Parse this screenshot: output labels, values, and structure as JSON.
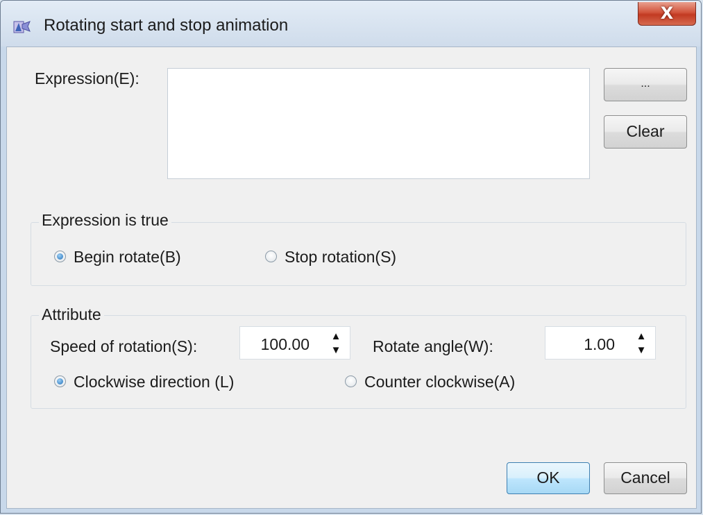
{
  "window": {
    "title": "Rotating start and stop animation",
    "close_label": "X"
  },
  "expression": {
    "label": "Expression(E):",
    "value": "",
    "browse_label": "...",
    "clear_label": "Clear"
  },
  "expression_true_group": {
    "title": "Expression is true",
    "options": [
      {
        "label": "Begin rotate(B)",
        "checked": true
      },
      {
        "label": "Stop rotation(S)",
        "checked": false
      }
    ]
  },
  "attribute_group": {
    "title": "Attribute",
    "speed_label": "Speed of rotation(S):",
    "speed_value": "100.00",
    "angle_label": "Rotate angle(W):",
    "angle_value": "1.00",
    "direction_options": [
      {
        "label": "Clockwise direction (L)",
        "checked": true
      },
      {
        "label": "Counter clockwise(A)",
        "checked": false
      }
    ]
  },
  "footer": {
    "ok_label": "OK",
    "cancel_label": "Cancel"
  },
  "icons": {
    "app": "app-icon",
    "close": "close-icon",
    "up": "spin-up-icon",
    "down": "spin-down-icon"
  },
  "colors": {
    "accent": "#1f6fb9",
    "close_button": "#c23a22"
  }
}
